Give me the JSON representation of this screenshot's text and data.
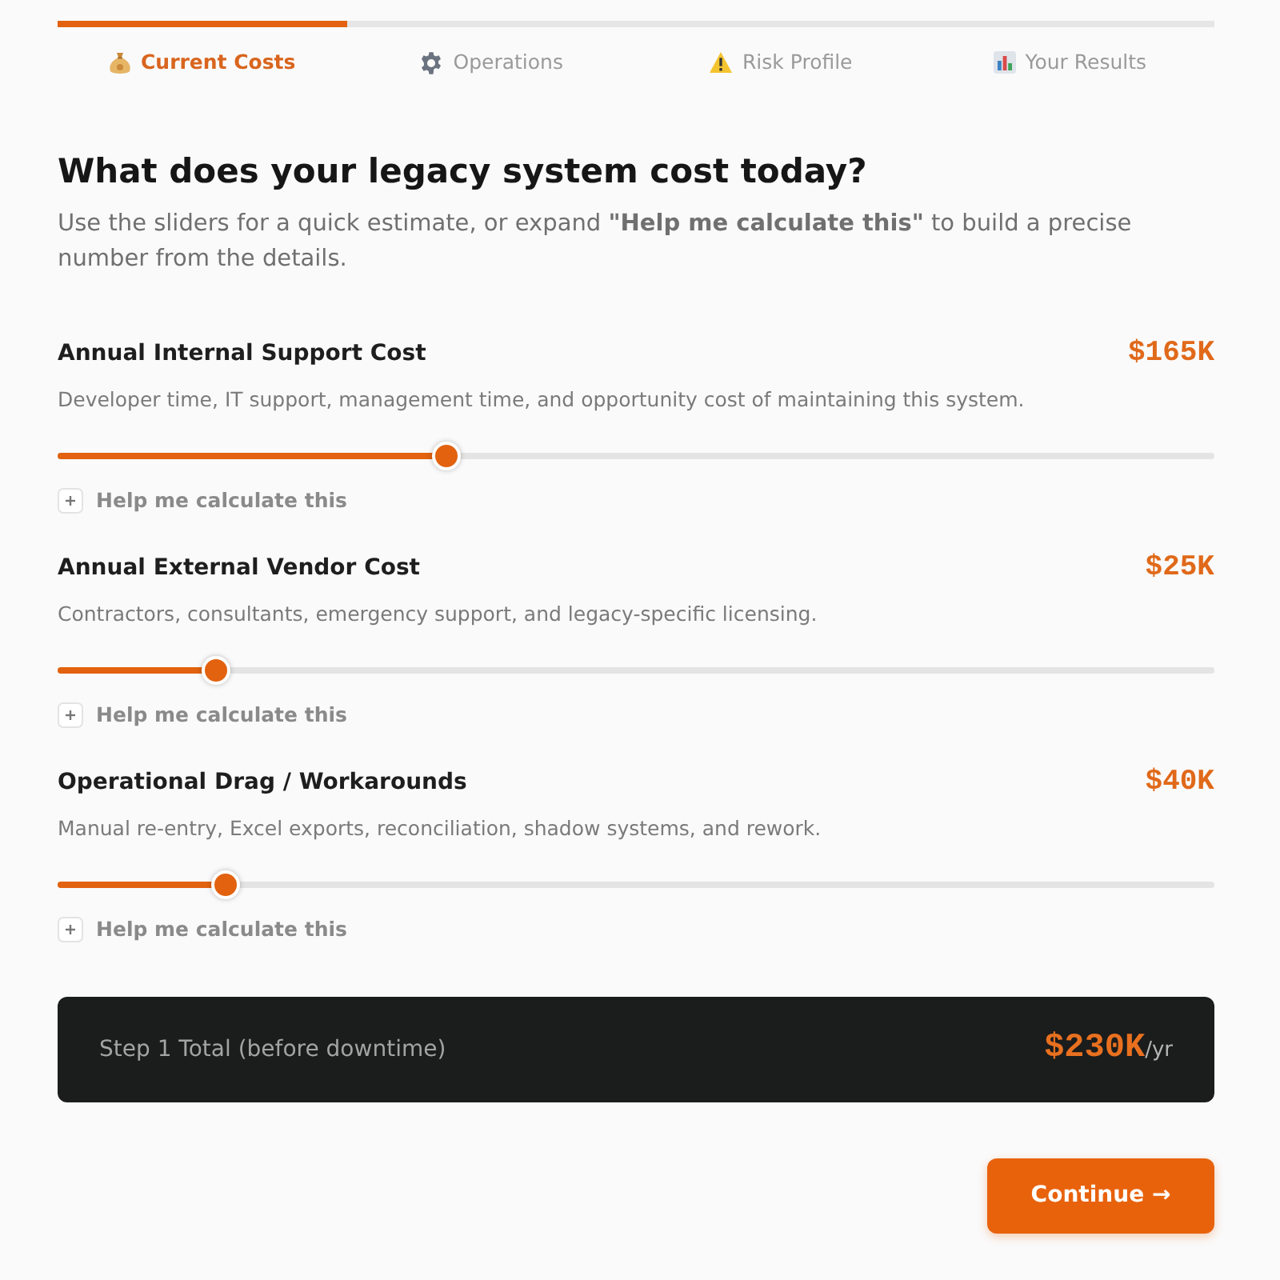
{
  "progress": {
    "level": 0.25
  },
  "steps": [
    {
      "kind": "money",
      "label": "Current Costs",
      "selected": true
    },
    {
      "kind": "gear",
      "label": "Operations",
      "selected": false
    },
    {
      "kind": "warning",
      "label": "Risk Profile",
      "selected": false
    },
    {
      "kind": "chart",
      "label": "Your Results",
      "selected": false
    }
  ],
  "heading": "What does your legacy system cost today?",
  "intro": "Use the sliders for a quick estimate, or expand **\"Help me calculate this\"** to build a precise number from the details.",
  "cost_items": [
    {
      "title": "Annual Internal Support Cost",
      "value": "$165K",
      "description": "Developer time, IT support, management time, and opportunity cost of maintaining this system.",
      "level": 0.336,
      "help": {
        "label": "Help me calculate this",
        "expanded": false
      }
    },
    {
      "title": "Annual External Vendor Cost",
      "value": "$25K",
      "description": "Contractors, consultants, emergency support, and legacy-specific licensing.",
      "level": 0.137,
      "help": {
        "label": "Help me calculate this",
        "expanded": false
      }
    },
    {
      "title": "Operational Drag / Workarounds",
      "value": "$40K",
      "description": "Manual re-entry, Excel exports, reconciliation, shadow systems, and rework.",
      "level": 0.145,
      "help": {
        "label": "Help me calculate this",
        "expanded": false
      }
    }
  ],
  "total": {
    "label": "Step 1 Total (before downtime)",
    "value": "$230K",
    "unit": "/yr"
  },
  "continue_button": {
    "label": "Continue →"
  }
}
